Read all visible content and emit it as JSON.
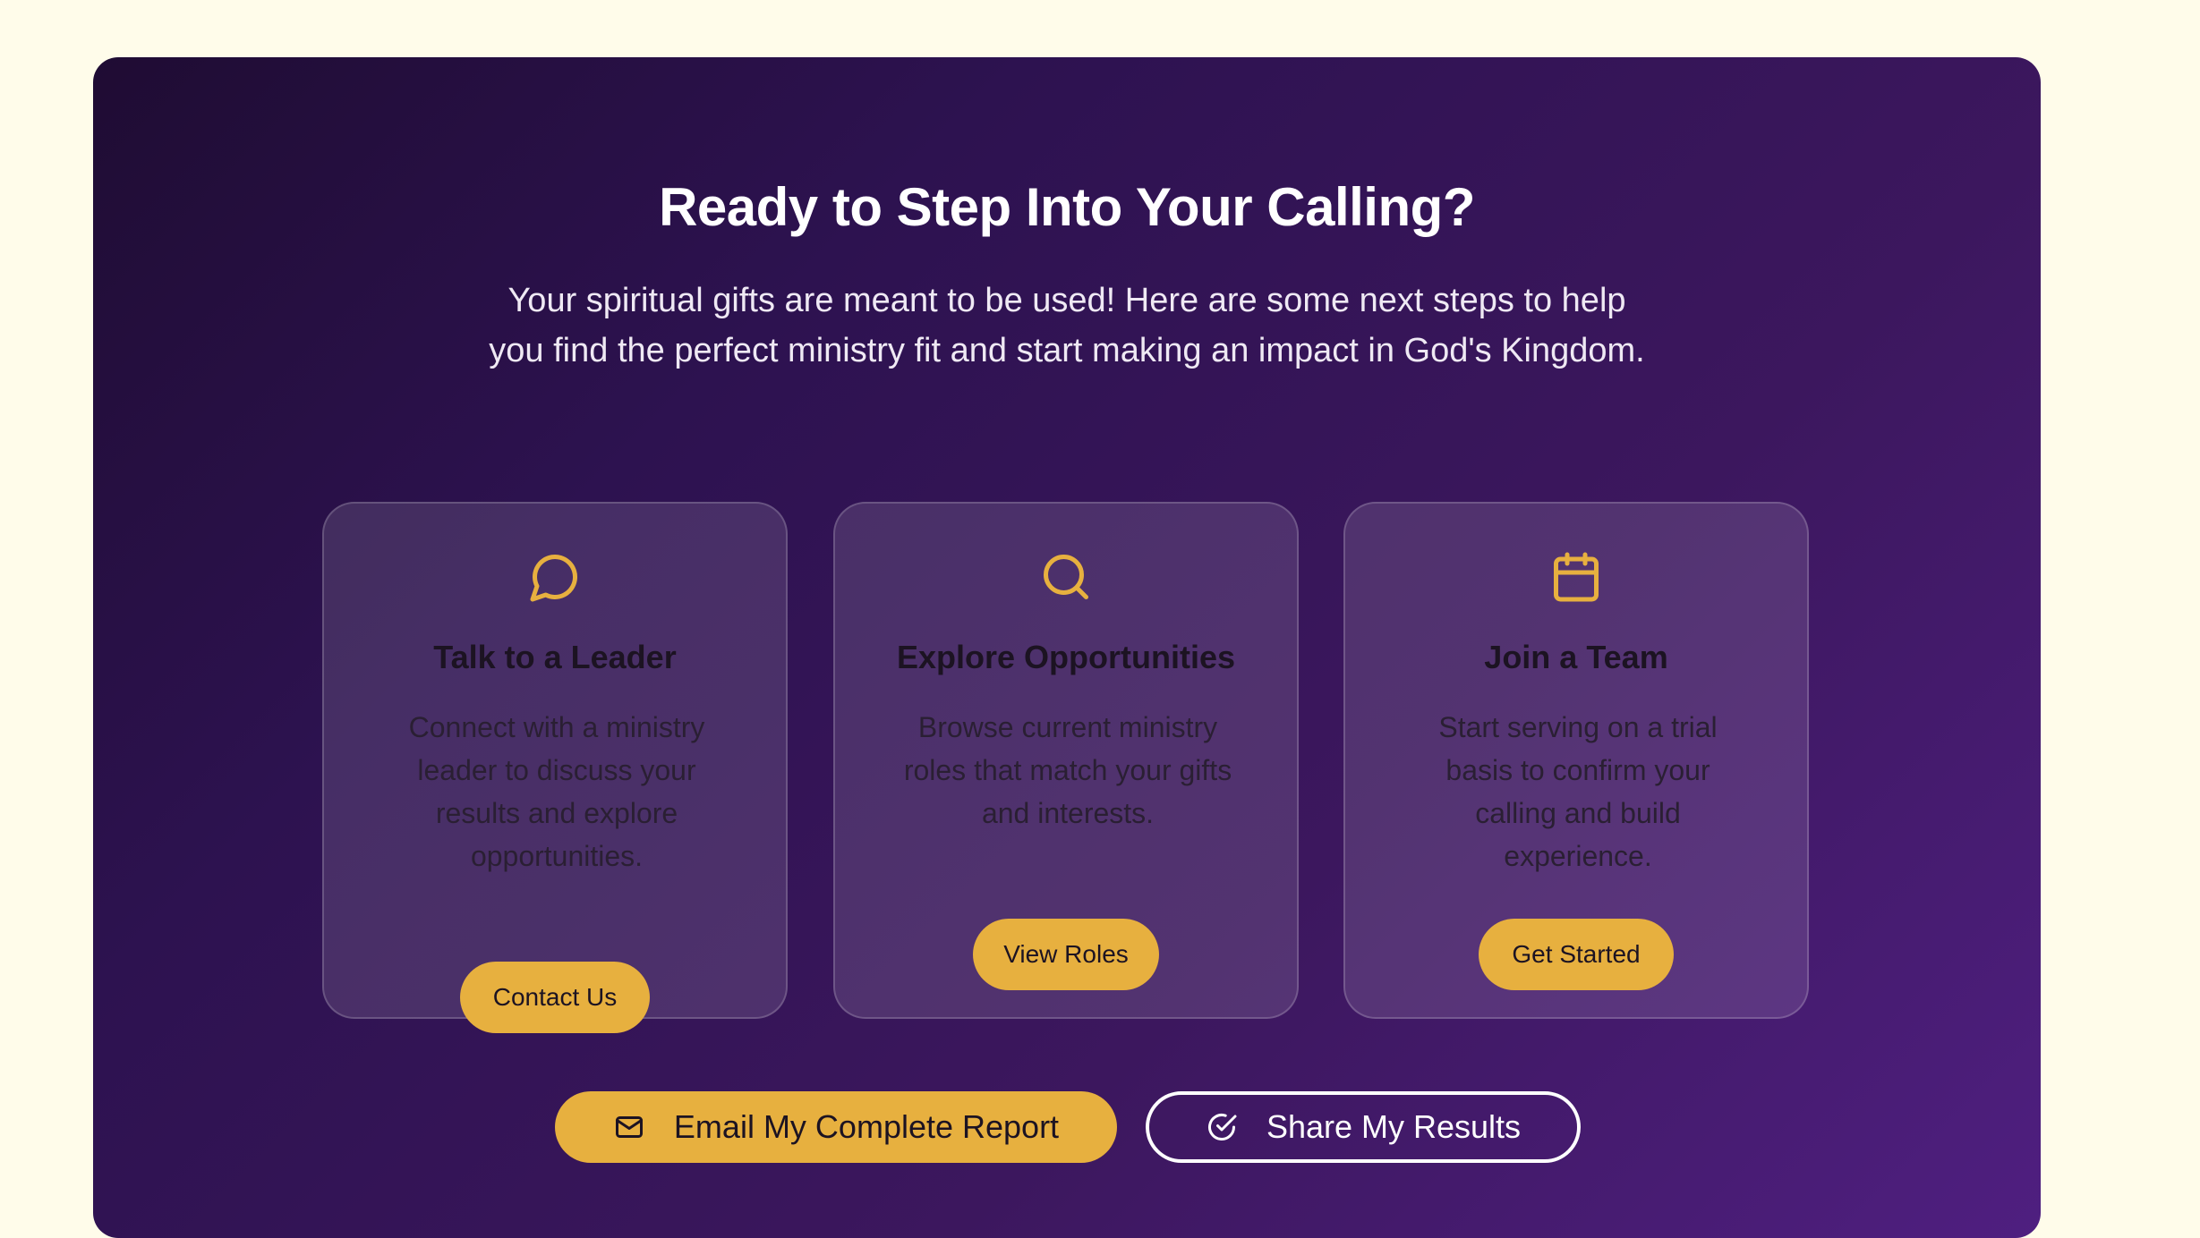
{
  "cta": {
    "title": "Ready to Step Into Your Calling?",
    "subtitle": "Your spiritual gifts are meant to be used! Here are some next steps to help you find the perfect ministry fit and start making an impact in God's Kingdom."
  },
  "cards": [
    {
      "icon": "chat-bubble-icon",
      "title": "Talk to a Leader",
      "description": "Connect with a ministry leader to discuss your results and explore opportunities.",
      "button": "Contact Us"
    },
    {
      "icon": "search-icon",
      "title": "Explore Opportunities",
      "description": "Browse current ministry roles that match your gifts and interests.",
      "button": "View Roles"
    },
    {
      "icon": "calendar-icon",
      "title": "Join a Team",
      "description": "Start serving on a trial basis to confirm your calling and build experience.",
      "button": "Get Started"
    }
  ],
  "actions": {
    "email_label": "Email My Complete Report",
    "email_icon": "mail-icon",
    "share_label": "Share My Results",
    "share_icon": "check-circle-icon"
  },
  "colors": {
    "accent": "#e7b03f",
    "page_background": "#fffcea",
    "panel_gradient_start": "#1f0c33",
    "panel_gradient_end": "#4f1f80"
  }
}
